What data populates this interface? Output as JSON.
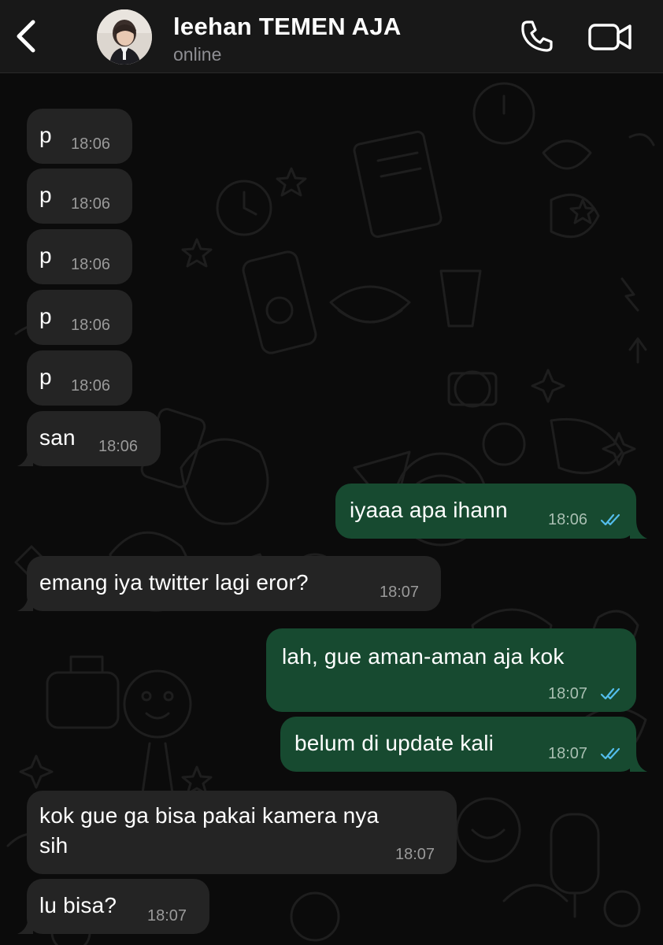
{
  "header": {
    "contact_name": "leehan TEMEN AJA",
    "status": "online"
  },
  "colors": {
    "header_bg": "#181818",
    "chat_bg": "#0b0b0b",
    "incoming_bubble": "#242424",
    "outgoing_bubble": "#174a30",
    "read_ticks": "#53bdeb"
  },
  "icons": [
    "back-icon",
    "call-icon",
    "video-call-icon",
    "read-ticks-icon"
  ],
  "messages": [
    {
      "direction": "in",
      "text": "p",
      "time": "18:06"
    },
    {
      "direction": "in",
      "text": "p",
      "time": "18:06"
    },
    {
      "direction": "in",
      "text": "p",
      "time": "18:06"
    },
    {
      "direction": "in",
      "text": "p",
      "time": "18:06"
    },
    {
      "direction": "in",
      "text": "p",
      "time": "18:06"
    },
    {
      "direction": "in",
      "text": "san",
      "time": "18:06"
    },
    {
      "direction": "out",
      "text": "iyaaa apa ihann",
      "time": "18:06",
      "read": true
    },
    {
      "direction": "in",
      "text": "emang iya twitter lagi eror?",
      "time": "18:07"
    },
    {
      "direction": "out",
      "text": "lah, gue aman-aman aja kok",
      "time": "18:07",
      "read": true
    },
    {
      "direction": "out",
      "text": "belum di update kali",
      "time": "18:07",
      "read": true
    },
    {
      "direction": "in",
      "text_line1": "kok gue ga bisa pakai kamera nya",
      "text_line2": "sih",
      "time": "18:07"
    },
    {
      "direction": "in",
      "text": "lu bisa?",
      "time": "18:07"
    }
  ]
}
